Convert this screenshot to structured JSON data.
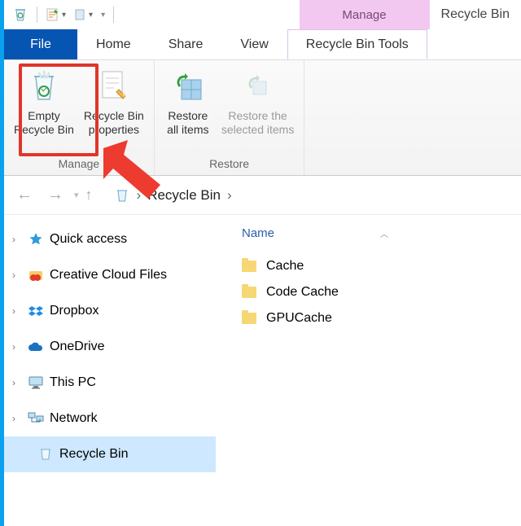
{
  "title": "Recycle Bin",
  "context_tab": "Manage",
  "tabs": {
    "file": "File",
    "home": "Home",
    "share": "Share",
    "view": "View",
    "tools": "Recycle Bin Tools"
  },
  "ribbon": {
    "empty": "Empty\nRecycle Bin",
    "props": "Recycle Bin\nproperties",
    "restore_all": "Restore\nall items",
    "restore_sel": "Restore the\nselected items",
    "group_manage": "Manage",
    "group_restore": "Restore"
  },
  "breadcrumb": {
    "root": "Recycle Bin"
  },
  "nav": {
    "quick": "Quick access",
    "ccf": "Creative Cloud Files",
    "dropbox": "Dropbox",
    "onedrive": "OneDrive",
    "thispc": "This PC",
    "network": "Network",
    "recycle": "Recycle Bin"
  },
  "content": {
    "col_name": "Name",
    "items": [
      "Cache",
      "Code Cache",
      "GPUCache"
    ]
  }
}
